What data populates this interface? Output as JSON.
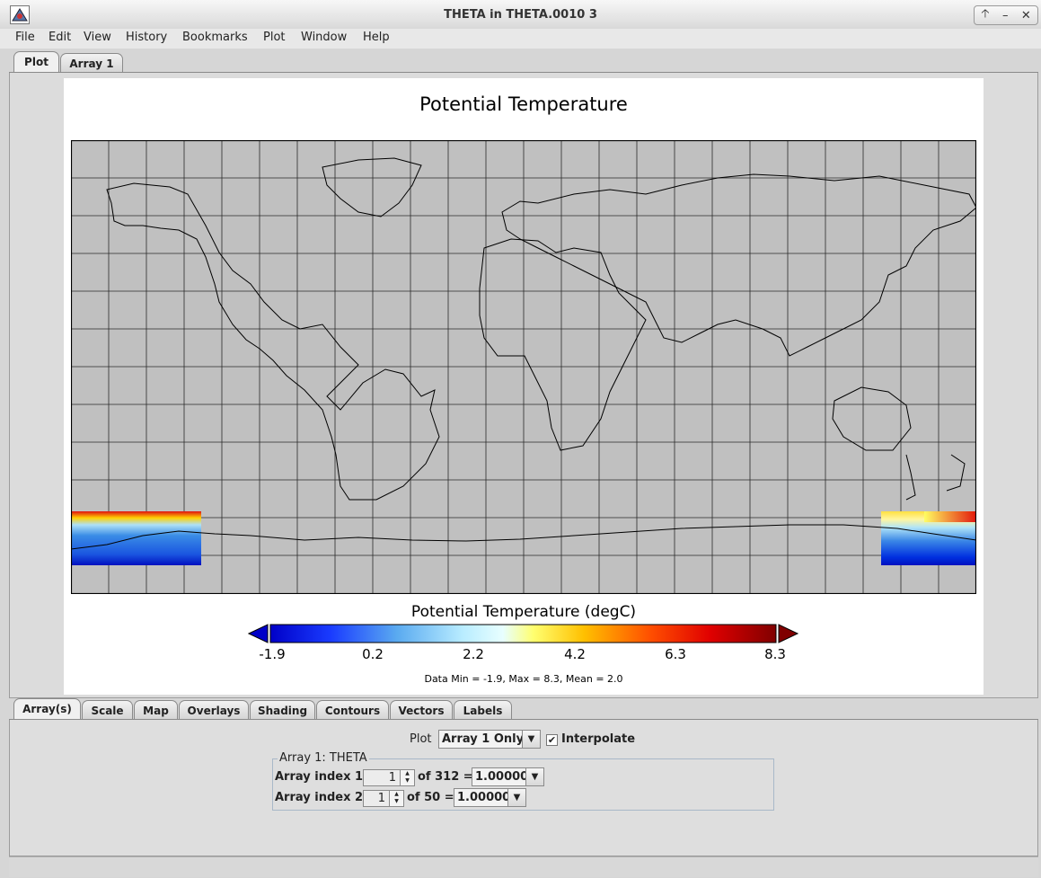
{
  "window": {
    "title": "THETA in THETA.0010 3"
  },
  "menu": [
    "File",
    "Edit",
    "View",
    "History",
    "Bookmarks",
    "Plot",
    "Window",
    "Help"
  ],
  "top_tabs": [
    {
      "label": "Plot",
      "active": true
    },
    {
      "label": "Array 1",
      "active": false
    }
  ],
  "plot": {
    "title": "Potential Temperature",
    "colorbar_title": "Potential Temperature (degC)",
    "colorbar_ticks": [
      "-1.9",
      "0.2",
      "2.2",
      "4.2",
      "6.3",
      "8.3"
    ],
    "stats": "Data Min = -1.9, Max = 8.3, Mean = 2.0",
    "colors": {
      "land_ocean_missing": "#c0c0c0",
      "coastline": "#000000",
      "grid": "#333333"
    }
  },
  "bottom_tabs": [
    {
      "label": "Array(s)",
      "active": true
    },
    {
      "label": "Scale",
      "active": false
    },
    {
      "label": "Map",
      "active": false
    },
    {
      "label": "Overlays",
      "active": false
    },
    {
      "label": "Shading",
      "active": false
    },
    {
      "label": "Contours",
      "active": false
    },
    {
      "label": "Vectors",
      "active": false
    },
    {
      "label": "Labels",
      "active": false
    }
  ],
  "controls": {
    "plot_label": "Plot",
    "plot_mode": "Array 1 Only",
    "interpolate_label": "Interpolate",
    "interpolate_checked": true,
    "group_title": "Array 1: THETA",
    "index1_label": "Array index 1:",
    "index1_value": "1",
    "index1_of": "of 312 =",
    "index1_coord": "1.00000",
    "index2_label": "Array index 2:",
    "index2_value": "1",
    "index2_of": "of 50 =",
    "index2_coord": "1.00000"
  }
}
